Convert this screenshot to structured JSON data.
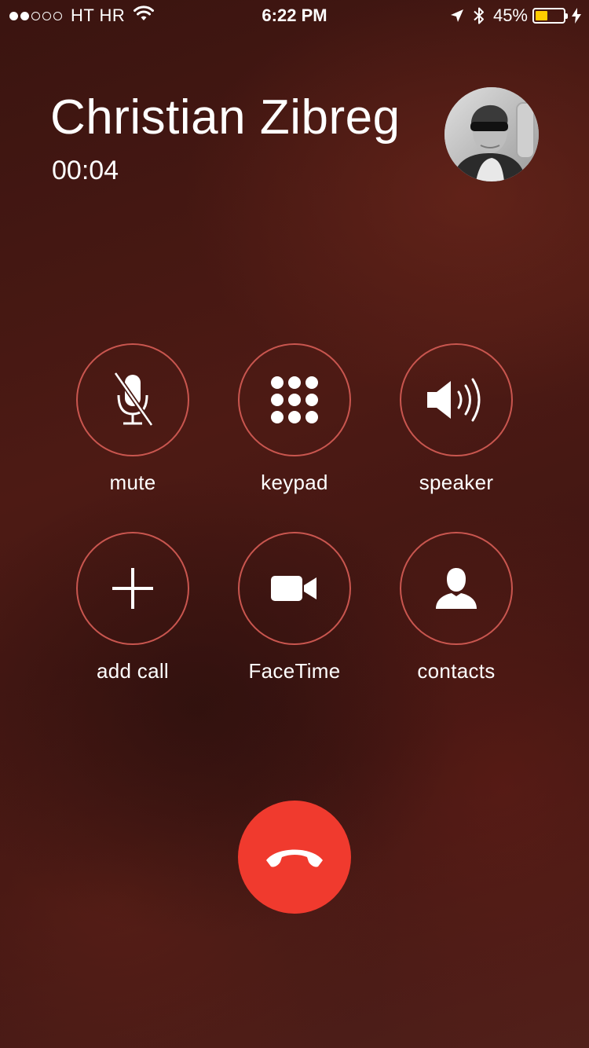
{
  "status_bar": {
    "signal_bars": [
      true,
      true,
      false,
      false,
      false
    ],
    "carrier": "HT HR",
    "time": "6:22 PM",
    "battery_percent": "45%",
    "battery_level": 0.45,
    "battery_color": "#ffcc00",
    "icons": [
      "wifi-icon",
      "location-arrow-icon",
      "bluetooth-icon",
      "battery-icon",
      "charging-bolt-icon"
    ]
  },
  "call": {
    "name": "Christian Zibreg",
    "duration": "00:04"
  },
  "controls": [
    {
      "id": "mute",
      "label": "mute",
      "icon": "mic-muted-icon"
    },
    {
      "id": "keypad",
      "label": "keypad",
      "icon": "keypad-icon"
    },
    {
      "id": "speaker",
      "label": "speaker",
      "icon": "speaker-icon"
    },
    {
      "id": "add-call",
      "label": "add call",
      "icon": "plus-icon"
    },
    {
      "id": "facetime",
      "label": "FaceTime",
      "icon": "video-camera-icon"
    },
    {
      "id": "contacts",
      "label": "contacts",
      "icon": "person-icon"
    }
  ],
  "end_call": {
    "icon": "phone-hangup-icon",
    "color": "#f03a2e"
  },
  "colors": {
    "ring": "#c9564f",
    "text": "#ffffff"
  }
}
